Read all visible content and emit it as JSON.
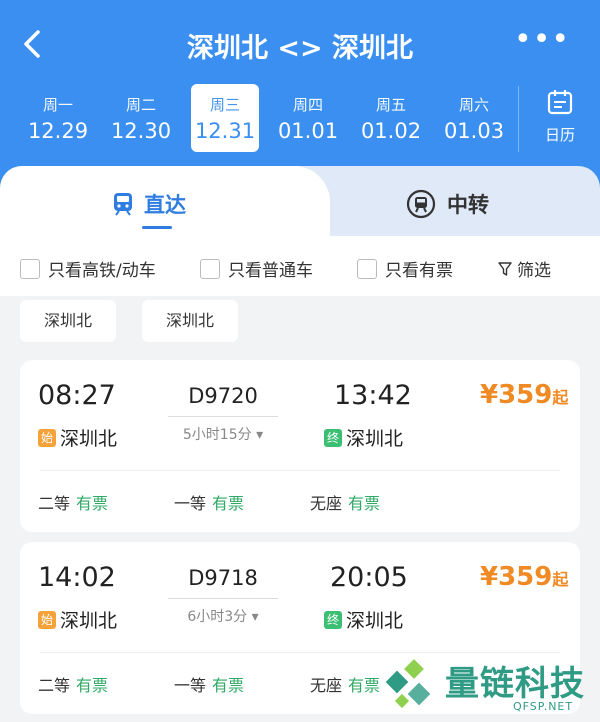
{
  "header": {
    "title": "深圳北 <> 深圳北",
    "back_icon": "chevron-left-icon",
    "more_icon": "more-horizontal-icon",
    "more_label": "•••"
  },
  "dates": [
    {
      "weekday": "周一",
      "date": "12.29",
      "active": false
    },
    {
      "weekday": "周二",
      "date": "12.30",
      "active": false
    },
    {
      "weekday": "周三",
      "date": "12.31",
      "active": true
    },
    {
      "weekday": "周四",
      "date": "01.01",
      "active": false
    },
    {
      "weekday": "周五",
      "date": "01.02",
      "active": false
    },
    {
      "weekday": "周六",
      "date": "01.03",
      "active": false
    }
  ],
  "calendar": {
    "label": "日历",
    "icon": "calendar-icon"
  },
  "tabs": {
    "direct": {
      "label": "直达",
      "icon": "train-icon"
    },
    "transfer": {
      "label": "中转",
      "icon": "transfer-train-icon"
    }
  },
  "filters": {
    "high_speed": "只看高铁/动车",
    "regular": "只看普通车",
    "available": "只看有票",
    "filter": "筛选",
    "filter_icon": "funnel-icon"
  },
  "station_chips": [
    "深圳北",
    "深圳北"
  ],
  "trains": [
    {
      "depart_time": "08:27",
      "arrive_time": "13:42",
      "train_no": "D9720",
      "duration": "5小时15分",
      "from_badge": "始",
      "from_station": "深圳北",
      "to_badge": "终",
      "to_station": "深圳北",
      "price": "¥359",
      "price_suffix": "起",
      "seats": [
        {
          "type": "二等",
          "status": "有票"
        },
        {
          "type": "一等",
          "status": "有票"
        },
        {
          "type": "无座",
          "status": "有票"
        }
      ]
    },
    {
      "depart_time": "14:02",
      "arrive_time": "20:05",
      "train_no": "D9718",
      "duration": "6小时3分",
      "from_badge": "始",
      "from_station": "深圳北",
      "to_badge": "终",
      "to_station": "深圳北",
      "price": "¥359",
      "price_suffix": "起",
      "seats": [
        {
          "type": "二等",
          "status": "有票"
        },
        {
          "type": "一等",
          "status": "有票"
        },
        {
          "type": "无座",
          "status": "有票"
        }
      ]
    }
  ],
  "watermark": {
    "text": "量链科技",
    "sub": "QFSP.NET"
  },
  "colors": {
    "primary": "#3a8ff0",
    "price": "#f08a24",
    "available": "#2fa865",
    "start_badge": "#f5a23b",
    "end_badge": "#3cbf73"
  }
}
